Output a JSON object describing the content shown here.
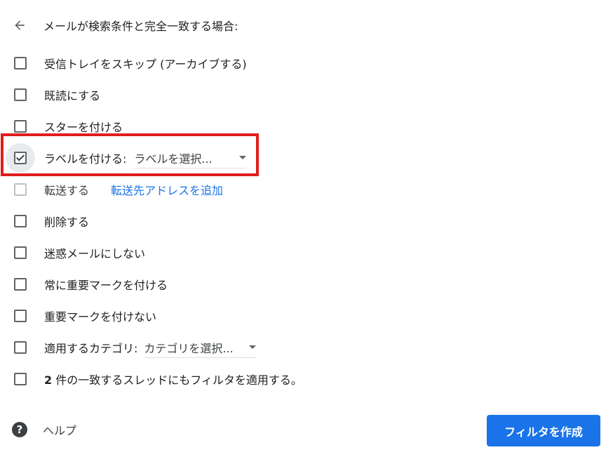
{
  "header": {
    "title": "メールが検索条件と完全一致する場合:"
  },
  "options": [
    {
      "label": "受信トレイをスキップ (アーカイブする)",
      "checked": false
    },
    {
      "label": "既読にする",
      "checked": false
    },
    {
      "label": "スターを付ける",
      "checked": false
    },
    {
      "label": "ラベルを付ける:",
      "checked": true,
      "select_value": "ラベルを選択..."
    },
    {
      "label": "転送する",
      "checked": false,
      "disabled": true,
      "link": "転送先アドレスを追加"
    },
    {
      "label": "削除する",
      "checked": false
    },
    {
      "label": "迷惑メールにしない",
      "checked": false
    },
    {
      "label": "常に重要マークを付ける",
      "checked": false
    },
    {
      "label": "重要マークを付けない",
      "checked": false
    },
    {
      "label": "適用するカテゴリ:",
      "checked": false,
      "select_value": "カテゴリを選択..."
    },
    {
      "label_count": "2",
      "label_rest": " 件の一致するスレッドにもフィルタを適用する。",
      "checked": false
    }
  ],
  "footer": {
    "help_label": "ヘルプ",
    "create_button": "フィルタを作成"
  },
  "icons": {
    "back": "arrow-left-icon",
    "help": "help-circle-icon",
    "dropdown": "caret-down-icon"
  },
  "colors": {
    "primary": "#1a73e8",
    "highlight": "#e01d1d",
    "text": "#202124",
    "icon": "#5f6368"
  }
}
